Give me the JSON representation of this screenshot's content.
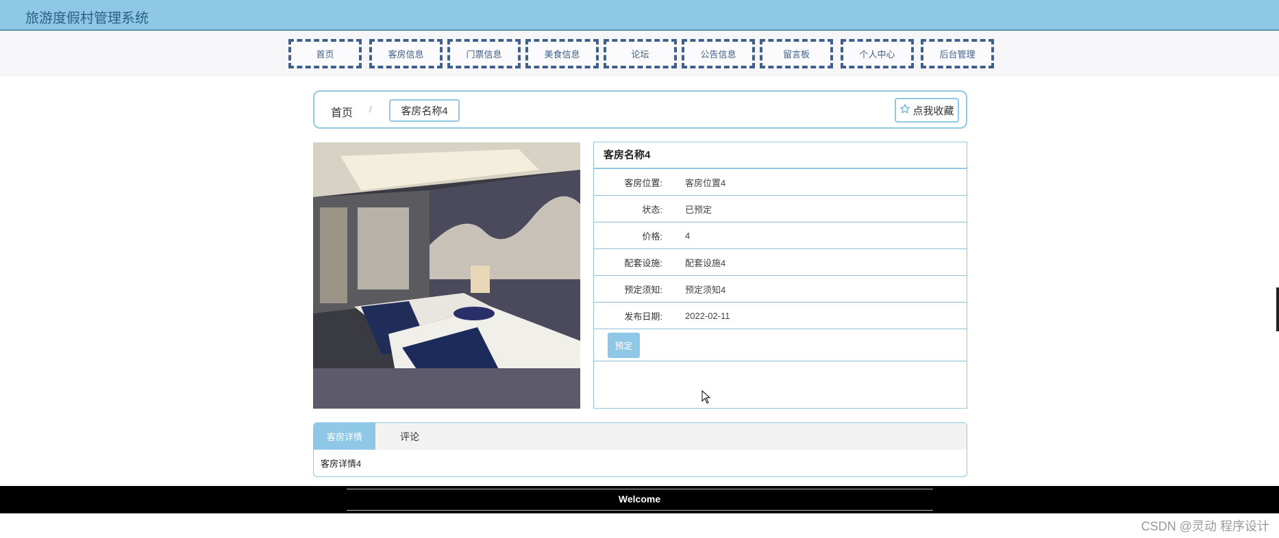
{
  "header": {
    "title": "旅游度假村管理系统"
  },
  "nav": {
    "items": [
      {
        "label": "首页"
      },
      {
        "label": "客房信息"
      },
      {
        "label": "门票信息"
      },
      {
        "label": "美食信息"
      },
      {
        "label": "论坛"
      },
      {
        "label": "公告信息"
      },
      {
        "label": "留言板"
      },
      {
        "label": "个人中心"
      },
      {
        "label": "后台管理"
      }
    ]
  },
  "breadcrumb": {
    "home": "首页",
    "separator": "/",
    "current": "客房名称4"
  },
  "favorite": {
    "label": "点我收藏",
    "icon": "star-icon"
  },
  "room": {
    "title": "客房名称4",
    "fields": [
      {
        "label": "客房位置:",
        "value": "客房位置4"
      },
      {
        "label": "状态:",
        "value": "已预定"
      },
      {
        "label": "价格:",
        "value": "4"
      },
      {
        "label": "配套设施:",
        "value": "配套设施4"
      },
      {
        "label": "预定须知:",
        "value": "预定须知4"
      },
      {
        "label": "发布日期:",
        "value": "2022-02-11"
      }
    ],
    "book_label": "预定"
  },
  "tabs": {
    "items": [
      {
        "label": "客房详情"
      },
      {
        "label": "评论"
      }
    ],
    "content": "客房详情4"
  },
  "footer": {
    "text": "Welcome"
  },
  "watermark": "CSDN @灵动 程序设计",
  "colors": {
    "accent": "#8ec8e6",
    "nav_border": "#3f5f8d",
    "footer_bg": "#000000"
  }
}
